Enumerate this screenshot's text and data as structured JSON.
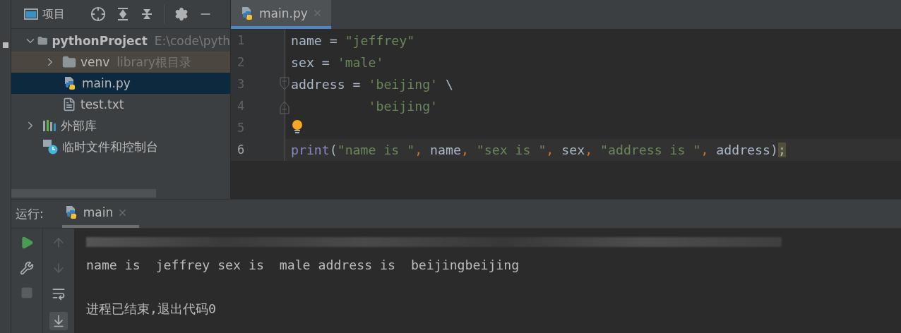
{
  "project_panel": {
    "title": "项目"
  },
  "tree": [
    {
      "label": "pythonProject",
      "hint": "E:\\code\\pyth",
      "kind": "folder",
      "expanded": true,
      "selected": false,
      "children": [
        {
          "label": "venv",
          "hint": "library根目录",
          "kind": "libroot",
          "expanded": false,
          "selected": false
        },
        {
          "label": "main.py",
          "kind": "python",
          "selected": true
        },
        {
          "label": "test.txt",
          "kind": "text",
          "selected": false
        }
      ]
    },
    {
      "label": "外部库",
      "kind": "library",
      "expanded": false,
      "selected": false
    },
    {
      "label": "临时文件和控制台",
      "kind": "scratch",
      "selected": false
    }
  ],
  "editor_tabs": [
    {
      "label": "main.py",
      "selected": true
    }
  ],
  "code": [
    {
      "number": "1",
      "current": false,
      "tokens": [
        {
          "kind": "plain",
          "text": "name = "
        },
        {
          "kind": "string",
          "text": "\"jeffrey\""
        }
      ]
    },
    {
      "number": "2",
      "current": false,
      "tokens": [
        {
          "kind": "plain",
          "text": "sex = "
        },
        {
          "kind": "string",
          "text": "'male'"
        }
      ]
    },
    {
      "number": "3",
      "current": false,
      "fold_start": true,
      "tokens": [
        {
          "kind": "plain",
          "text": "address = "
        },
        {
          "kind": "string",
          "text": "'beijing'"
        },
        {
          "kind": "plain",
          "text": " \\"
        }
      ]
    },
    {
      "number": "4",
      "current": false,
      "fold_end": true,
      "tokens": [
        {
          "kind": "string",
          "text": "          'beijing'"
        }
      ]
    },
    {
      "number": "5",
      "current": false,
      "intention": true
    },
    {
      "number": "6",
      "current": true,
      "tokens": [
        {
          "kind": "builtin",
          "text": "print"
        },
        {
          "kind": "plain",
          "text": "("
        },
        {
          "kind": "string",
          "text": "\"name is \""
        },
        {
          "kind": "comma",
          "text": ","
        },
        {
          "kind": "plain",
          "text": " name"
        },
        {
          "kind": "comma",
          "text": ","
        },
        {
          "kind": "string",
          "text": " \"sex is \""
        },
        {
          "kind": "comma",
          "text": ","
        },
        {
          "kind": "plain",
          "text": " sex"
        },
        {
          "kind": "comma",
          "text": ","
        },
        {
          "kind": "string",
          "text": " \"address is \""
        },
        {
          "kind": "comma",
          "text": ","
        },
        {
          "kind": "plain",
          "text": " address)"
        },
        {
          "kind": "warn",
          "text": ";"
        }
      ]
    }
  ],
  "run_panel": {
    "label": "运行:",
    "tabs": [
      {
        "label": "main",
        "selected": true
      }
    ]
  },
  "console": [
    {
      "kind": "blurred"
    },
    {
      "kind": "out",
      "text": "name is  jeffrey sex is  male address is  beijingbeijing"
    },
    {
      "kind": "blank"
    },
    {
      "kind": "out",
      "text": "进程已结束,退出代码0"
    }
  ]
}
